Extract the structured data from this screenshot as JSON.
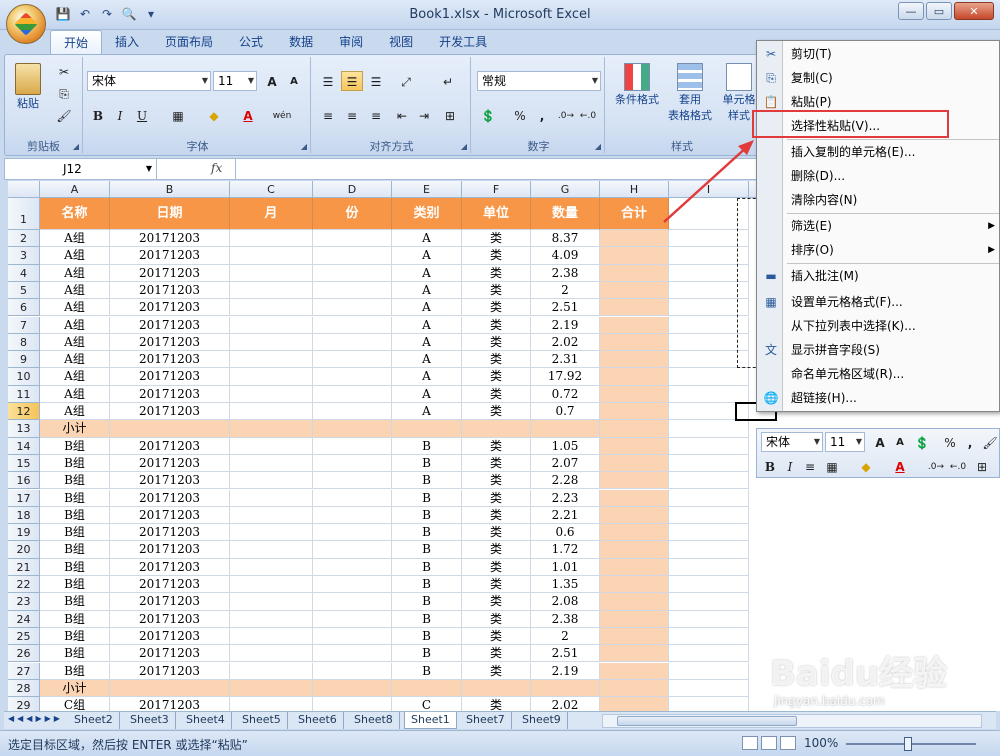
{
  "window": {
    "title": "Book1.xlsx - Microsoft Excel",
    "min": "—",
    "max": "▭",
    "close": "✕"
  },
  "qat": {
    "save": "💾",
    "undo": "↶",
    "redo": "↷",
    "preview": "🔍",
    "customize": "▾"
  },
  "tabs": [
    "开始",
    "插入",
    "页面布局",
    "公式",
    "数据",
    "审阅",
    "视图",
    "开发工具"
  ],
  "ribbon": {
    "clipboard": {
      "label": "剪贴板",
      "paste": "粘贴"
    },
    "font": {
      "label": "字体",
      "name": "宋体",
      "size": "11",
      "grow": "A",
      "shrink": "A",
      "bold": "B",
      "italic": "I",
      "underline": "U",
      "phonetic": "wén"
    },
    "align": {
      "label": "对齐方式"
    },
    "number": {
      "label": "数字",
      "format": "常规",
      "percent": "%",
      "comma": ","
    },
    "styles": {
      "label": "样式",
      "cond": "条件格式",
      "table1": "套用",
      "table2": "表格格式",
      "cell1": "单元格",
      "cell2": "样式"
    }
  },
  "formula_bar": {
    "namebox": "J12",
    "fx": "fx",
    "content": ""
  },
  "columns": [
    "A",
    "B",
    "C",
    "D",
    "E",
    "F",
    "G",
    "H",
    "I"
  ],
  "header_row": [
    "名称",
    "日期",
    "月",
    "份",
    "类别",
    "单位",
    "数量",
    "合计"
  ],
  "rows": [
    {
      "n": "1",
      "cells": [
        "",
        "",
        "",
        "",
        "",
        "",
        "",
        ""
      ]
    },
    {
      "n": "2",
      "cells": [
        "A组",
        "20171203",
        "",
        "",
        "A",
        "类",
        "8.37",
        ""
      ]
    },
    {
      "n": "3",
      "cells": [
        "A组",
        "20171203",
        "",
        "",
        "A",
        "类",
        "4.09",
        ""
      ]
    },
    {
      "n": "4",
      "cells": [
        "A组",
        "20171203",
        "",
        "",
        "A",
        "类",
        "2.38",
        ""
      ]
    },
    {
      "n": "5",
      "cells": [
        "A组",
        "20171203",
        "",
        "",
        "A",
        "类",
        "2",
        ""
      ]
    },
    {
      "n": "6",
      "cells": [
        "A组",
        "20171203",
        "",
        "",
        "A",
        "类",
        "2.51",
        ""
      ]
    },
    {
      "n": "7",
      "cells": [
        "A组",
        "20171203",
        "",
        "",
        "A",
        "类",
        "2.19",
        ""
      ]
    },
    {
      "n": "8",
      "cells": [
        "A组",
        "20171203",
        "",
        "",
        "A",
        "类",
        "2.02",
        ""
      ]
    },
    {
      "n": "9",
      "cells": [
        "A组",
        "20171203",
        "",
        "",
        "A",
        "类",
        "2.31",
        ""
      ]
    },
    {
      "n": "10",
      "cells": [
        "A组",
        "20171203",
        "",
        "",
        "A",
        "类",
        "17.92",
        ""
      ]
    },
    {
      "n": "11",
      "cells": [
        "A组",
        "20171203",
        "",
        "",
        "A",
        "类",
        "0.72",
        ""
      ]
    },
    {
      "n": "12",
      "cells": [
        "A组",
        "20171203",
        "",
        "",
        "A",
        "类",
        "0.7",
        ""
      ]
    },
    {
      "n": "13",
      "cells": [
        "小计",
        "",
        "",
        "",
        "",
        "",
        "",
        ""
      ]
    },
    {
      "n": "14",
      "cells": [
        "B组",
        "20171203",
        "",
        "",
        "B",
        "类",
        "1.05",
        ""
      ]
    },
    {
      "n": "15",
      "cells": [
        "B组",
        "20171203",
        "",
        "",
        "B",
        "类",
        "2.07",
        ""
      ]
    },
    {
      "n": "16",
      "cells": [
        "B组",
        "20171203",
        "",
        "",
        "B",
        "类",
        "2.28",
        ""
      ]
    },
    {
      "n": "17",
      "cells": [
        "B组",
        "20171203",
        "",
        "",
        "B",
        "类",
        "2.23",
        ""
      ]
    },
    {
      "n": "18",
      "cells": [
        "B组",
        "20171203",
        "",
        "",
        "B",
        "类",
        "2.21",
        ""
      ]
    },
    {
      "n": "19",
      "cells": [
        "B组",
        "20171203",
        "",
        "",
        "B",
        "类",
        "0.6",
        ""
      ]
    },
    {
      "n": "20",
      "cells": [
        "B组",
        "20171203",
        "",
        "",
        "B",
        "类",
        "1.72",
        ""
      ]
    },
    {
      "n": "21",
      "cells": [
        "B组",
        "20171203",
        "",
        "",
        "B",
        "类",
        "1.01",
        ""
      ]
    },
    {
      "n": "22",
      "cells": [
        "B组",
        "20171203",
        "",
        "",
        "B",
        "类",
        "1.35",
        ""
      ]
    },
    {
      "n": "23",
      "cells": [
        "B组",
        "20171203",
        "",
        "",
        "B",
        "类",
        "2.08",
        ""
      ]
    },
    {
      "n": "24",
      "cells": [
        "B组",
        "20171203",
        "",
        "",
        "B",
        "类",
        "2.38",
        ""
      ]
    },
    {
      "n": "25",
      "cells": [
        "B组",
        "20171203",
        "",
        "",
        "B",
        "类",
        "2",
        ""
      ]
    },
    {
      "n": "26",
      "cells": [
        "B组",
        "20171203",
        "",
        "",
        "B",
        "类",
        "2.51",
        ""
      ]
    },
    {
      "n": "27",
      "cells": [
        "B组",
        "20171203",
        "",
        "",
        "B",
        "类",
        "2.19",
        ""
      ]
    },
    {
      "n": "28",
      "cells": [
        "小计",
        "",
        "",
        "",
        "",
        "",
        "",
        ""
      ]
    },
    {
      "n": "29",
      "cells": [
        "C组",
        "20171203",
        "",
        "",
        "C",
        "类",
        "2.02",
        ""
      ]
    }
  ],
  "sheets": [
    "Sheet2",
    "Sheet3",
    "Sheet4",
    "Sheet5",
    "Sheet6",
    "Sheet8",
    "Sheet1",
    "Sheet7",
    "Sheet9"
  ],
  "active_sheet": "Sheet1",
  "status": {
    "text": "选定目标区域，然后按 ENTER 或选择“粘贴”",
    "zoom": "100%"
  },
  "context_menu": [
    {
      "label": "剪切(T)",
      "icon": "scissors-icon",
      "glyph": "✂"
    },
    {
      "label": "复制(C)",
      "icon": "copy-icon",
      "glyph": "⎘"
    },
    {
      "label": "粘贴(P)",
      "icon": "paste-icon",
      "glyph": "📋"
    },
    {
      "label": "选择性粘贴(V)...",
      "icon": "",
      "glyph": ""
    },
    {
      "label": "插入复制的单元格(E)...",
      "icon": "",
      "glyph": ""
    },
    {
      "label": "删除(D)...",
      "icon": "",
      "glyph": ""
    },
    {
      "label": "清除内容(N)",
      "icon": "",
      "glyph": ""
    },
    {
      "label": "筛选(E)",
      "icon": "",
      "glyph": "",
      "submenu": true
    },
    {
      "label": "排序(O)",
      "icon": "",
      "glyph": "",
      "submenu": true
    },
    {
      "label": "插入批注(M)",
      "icon": "comment-icon",
      "glyph": "▬"
    },
    {
      "label": "设置单元格格式(F)...",
      "icon": "format-cells-icon",
      "glyph": "▦"
    },
    {
      "label": "从下拉列表中选择(K)...",
      "icon": "",
      "glyph": ""
    },
    {
      "label": "显示拼音字段(S)",
      "icon": "phonetic-icon",
      "glyph": "文"
    },
    {
      "label": "命名单元格区域(R)...",
      "icon": "",
      "glyph": ""
    },
    {
      "label": "超链接(H)...",
      "icon": "hyperlink-icon",
      "glyph": "🌐"
    }
  ],
  "mini_toolbar": {
    "font": "宋体",
    "size": "11",
    "percent": "%",
    "comma": ","
  },
  "watermark": {
    "brand": "Baidu经验",
    "url": "jingyan.baidu.com"
  },
  "colors": {
    "header_orange": "#f79646",
    "total_peach": "#fbd4b4",
    "highlight_red": "#e23a3a"
  }
}
